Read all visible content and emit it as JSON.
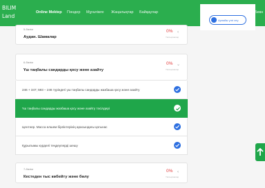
{
  "logo": {
    "line1": "BILIM",
    "line2": "Land"
  },
  "nav": [
    "Online Mektep",
    "Пәндер",
    "Мұғалімге",
    "Жаңалықтар",
    "Байқаулар"
  ],
  "user": {
    "name": "Бекн"
  },
  "side": {
    "button_label": "Арнайы үлгі өту"
  },
  "cards": [
    {
      "sub": "5-бөлім",
      "title": "Аудан. Шамалар",
      "pct": "0%",
      "pct_caption": "Тапсырмалар"
    },
    {
      "sub": "6-бөлім",
      "title": "Үш таңбалы сандарды қосу және азайту",
      "pct": "0%",
      "pct_caption": "Тапсырмалар"
    },
    {
      "sub": "7-бөлім",
      "title": "Кестеден тыс көбейту және бөлу",
      "pct": "0%",
      "pct_caption": "Тапсырмалар"
    }
  ],
  "rows": [
    {
      "text": "246 + 347; 593 – 246 түріндегі үш таңбалы сандарды жазбаша қосу және азайту"
    },
    {
      "text": "Үш таңбалы сандарды жазбаша қосу және азайту тәсілдері"
    },
    {
      "text": "Центнер. Масса өлшем бірліктерінің арасындағы қатынас"
    },
    {
      "text": "Құрылымы күрделі теңдеулерді шешу"
    }
  ],
  "colors": {
    "brand": "#2bae4e",
    "active_row": "#1fa64a",
    "check": "#2d6fe0",
    "percent": "#e23a3a"
  }
}
